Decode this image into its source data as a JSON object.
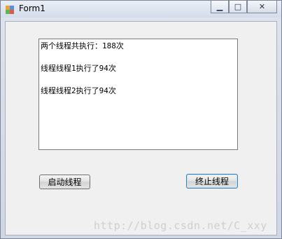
{
  "window": {
    "title": "Form1",
    "buttons": {
      "minimize": "▁",
      "maximize": "□",
      "close": "✕"
    }
  },
  "output": {
    "lines": [
      "两个线程共执行：188次",
      "",
      "线程线程1执行了94次",
      "",
      "线程线程2执行了94次"
    ]
  },
  "controls": {
    "start_label": "启动线程",
    "stop_label": "终止线程"
  },
  "watermark": "http://blog.csdn.net/C_xxy"
}
